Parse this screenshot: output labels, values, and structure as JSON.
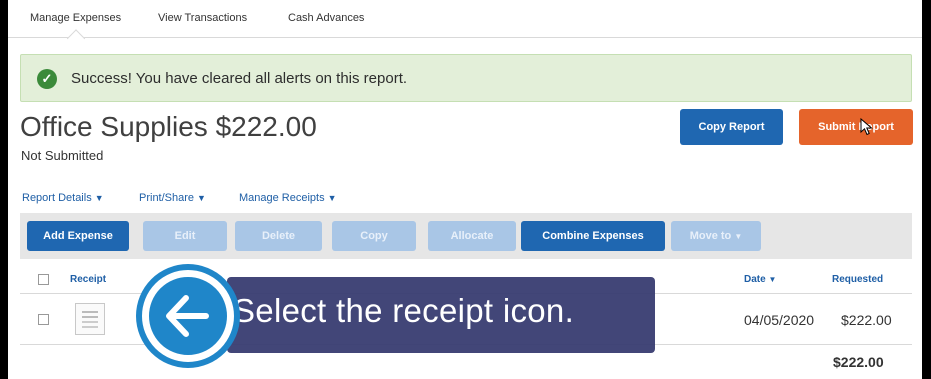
{
  "nav": {
    "tabs": [
      {
        "label": "Manage Expenses"
      },
      {
        "label": "View Transactions"
      },
      {
        "label": "Cash Advances"
      }
    ]
  },
  "alert": {
    "message": "Success! You have cleared all alerts on this report.",
    "icon": "check-icon",
    "color": "#3b8a3a"
  },
  "report": {
    "title": "Office Supplies $222.00",
    "status": "Not Submitted"
  },
  "actions": {
    "copy_label": "Copy Report",
    "submit_label": "Submit Report"
  },
  "subnav": {
    "report_details": "Report Details",
    "print_share": "Print/Share",
    "manage_receipts": "Manage Receipts"
  },
  "toolbar": {
    "add_expense": "Add Expense",
    "edit": "Edit",
    "delete": "Delete",
    "copy": "Copy",
    "allocate": "Allocate",
    "combine": "Combine Expenses",
    "move_to": "Move to"
  },
  "table": {
    "headers": {
      "receipt": "Receipt",
      "date": "Date",
      "requested": "Requested"
    },
    "rows": [
      {
        "date": "04/05/2020",
        "requested": "$222.00"
      }
    ],
    "total": "$222.00"
  },
  "callout": {
    "text": "Select the receipt icon."
  },
  "colors": {
    "primary_blue": "#1f67b1",
    "submit_orange": "#e5642b",
    "success_bg": "#e3efd9",
    "overlay": "#34386e"
  }
}
